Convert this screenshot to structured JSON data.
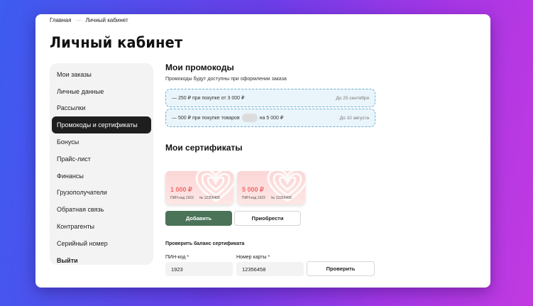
{
  "breadcrumbs": {
    "home": "Главная",
    "current": "Личный кабинет"
  },
  "page_title": "Личный кабинет",
  "sidebar": {
    "items": [
      {
        "label": "Мои заказы"
      },
      {
        "label": "Личные данные"
      },
      {
        "label": "Рассылки"
      },
      {
        "label": "Промокоды и сертификаты"
      },
      {
        "label": "Бонусы"
      },
      {
        "label": "Прайс-лист"
      },
      {
        "label": "Финансы"
      },
      {
        "label": "Грузополучатели"
      },
      {
        "label": "Обратная связь"
      },
      {
        "label": "Контрагенты"
      },
      {
        "label": "Серийный номер"
      },
      {
        "label": "Выйти"
      }
    ]
  },
  "promocodes": {
    "title": "Мои промокоды",
    "subtitle": "Промокоды будут доступны при оформлении заказа",
    "items": [
      {
        "text": "— 250 ₽ при покупке от 3 000 ₽",
        "until": "До 25 сентября"
      },
      {
        "text_before": "— 500 ₽ при покупке товаров",
        "text_after": "на 5 000 ₽",
        "until": "До 10 августа"
      }
    ]
  },
  "certificates": {
    "title": "Мои сертификаты",
    "items": [
      {
        "amount": "1 000 ₽",
        "pin": "ПИН-код 1923",
        "number": "№ 12356458"
      },
      {
        "amount": "5 000 ₽",
        "pin": "ПИН-код 1923",
        "number": "№ 12356458"
      }
    ],
    "add_label": "Добавить",
    "buy_label": "Приобрести"
  },
  "balance_check": {
    "title": "Проверить баланс сертификата",
    "pin_label": "ПИН-код *",
    "pin_value": "1923",
    "card_label": "Номер карты *",
    "card_value": "12356458",
    "check_label": "Проверить"
  },
  "colors": {
    "accent_green": "#4a7358",
    "active_nav": "#1e1e1e",
    "promo_border": "#6faed0",
    "cert_amount": "#f06a6a"
  }
}
